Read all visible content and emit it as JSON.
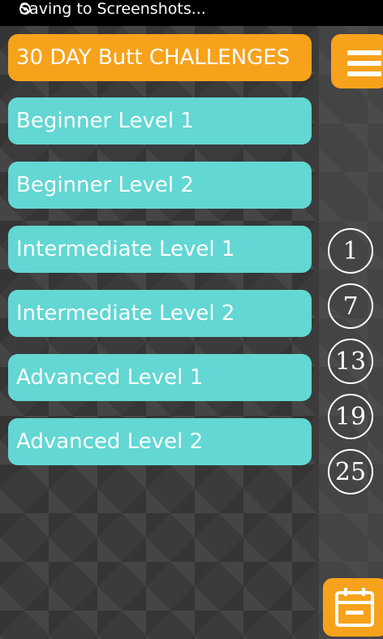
{
  "status": {
    "text": "Saving to Screenshots..."
  },
  "header": {
    "title": "30 DAY Butt CHALLENGES",
    "menu_icon": "hamburger-menu-icon"
  },
  "levels": [
    {
      "label": "Beginner Level 1"
    },
    {
      "label": "Beginner Level 2"
    },
    {
      "label": "Intermediate Level 1"
    },
    {
      "label": "Intermediate Level 2"
    },
    {
      "label": "Advanced Level 1"
    },
    {
      "label": "Advanced Level 2"
    }
  ],
  "days": [
    "1",
    "7",
    "13",
    "19",
    "25"
  ],
  "footer": {
    "calendar_icon": "calendar-icon"
  },
  "colors": {
    "accent": "#f7a21b",
    "level": "#62d7d3",
    "background": "#3b3b3b"
  }
}
